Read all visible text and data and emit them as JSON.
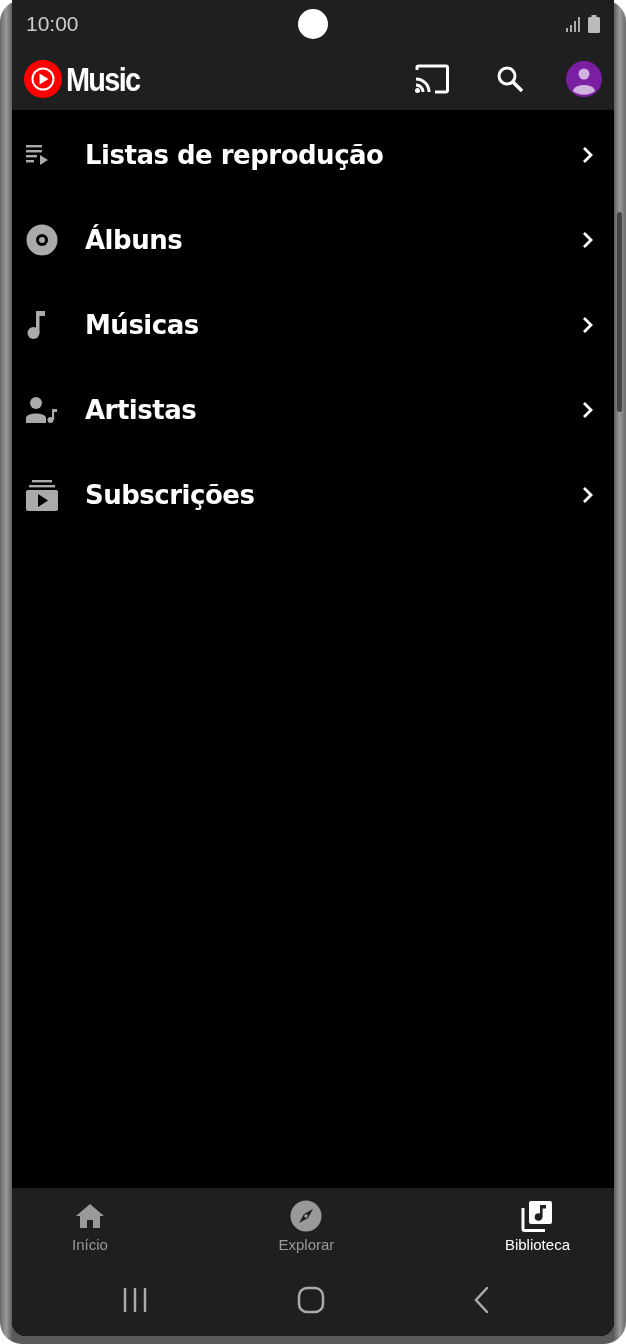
{
  "status_bar": {
    "time": "10:00"
  },
  "app_bar": {
    "title": "Music"
  },
  "library_items": [
    {
      "label": "Listas de reprodução"
    },
    {
      "label": "Álbuns"
    },
    {
      "label": "Músicas"
    },
    {
      "label": "Artistas"
    },
    {
      "label": "Subscrições"
    }
  ],
  "bottom_nav": [
    {
      "label": "Início",
      "selected": false
    },
    {
      "label": "Explorar",
      "selected": false
    },
    {
      "label": "Biblioteca",
      "selected": true
    }
  ]
}
